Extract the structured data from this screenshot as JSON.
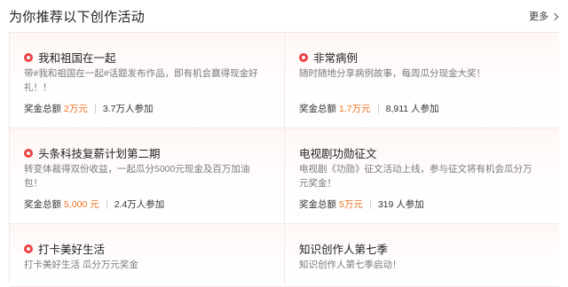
{
  "header": {
    "title": "为你推荐以下创作活动",
    "more_label": "更多"
  },
  "cards": [
    {
      "title": "我和祖国在一起",
      "hot": true,
      "desc": "带#我和祖国在一起#话题发布作品，即有机会赢得现金好礼！！",
      "prize_label": "奖金总额",
      "prize": "2万元",
      "participants": "3.7万人参加"
    },
    {
      "title": "非常病例",
      "hot": true,
      "desc": "随时随地分享病例故事，每周瓜分现金大奖！",
      "prize_label": "奖金总额",
      "prize": "1.7万元",
      "participants": "8,911 人参加"
    },
    {
      "title": "头条科技复薪计划第二期",
      "hot": true,
      "desc": "转变体裁得双份收益，一起瓜分5000元现金及百万加油包！",
      "prize_label": "奖金总额",
      "prize": "5,000 元",
      "participants": "2.4万人参加"
    },
    {
      "title": "电视剧功勋征文",
      "hot": false,
      "desc": "电视剧《功勋》征文活动上线，参与征文将有机会瓜分万元奖金！",
      "prize_label": "奖金总额",
      "prize": "5万元",
      "participants": "319 人参加"
    },
    {
      "title": "打卡美好生活",
      "hot": true,
      "desc": "打卡美好生活 瓜分万元奖金",
      "prize_label": "",
      "prize": "",
      "participants": ""
    },
    {
      "title": "知识创作人第七季",
      "hot": false,
      "desc": "知识创作人第七季启动！",
      "prize_label": "",
      "prize": "",
      "participants": ""
    }
  ],
  "colors": {
    "accent": "#f0701c",
    "hot_icon": "#f04142"
  }
}
